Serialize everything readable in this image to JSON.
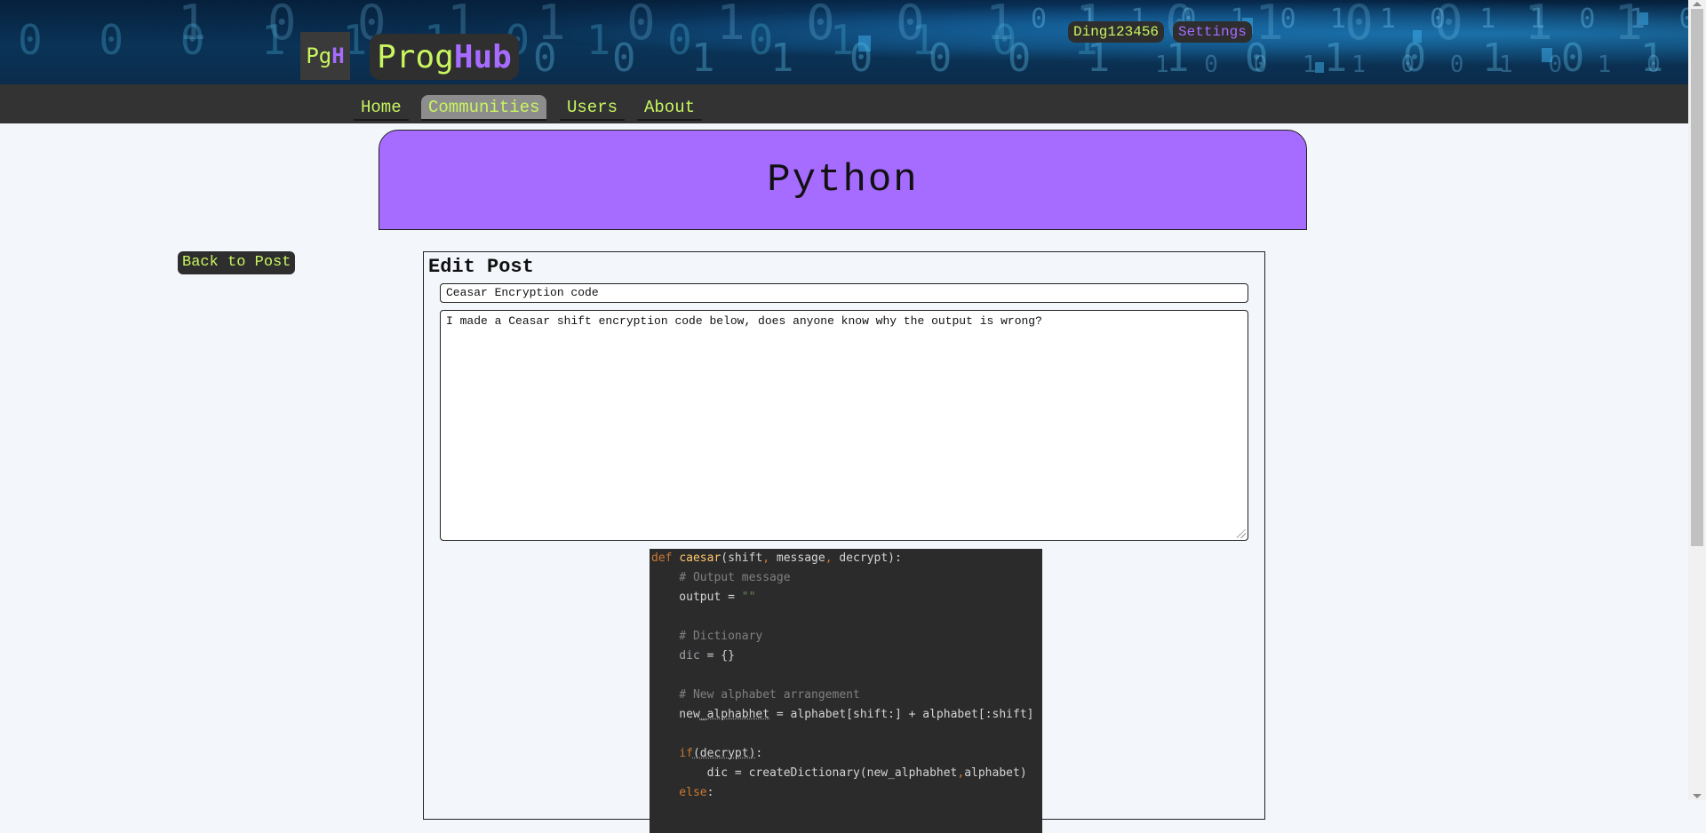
{
  "header": {
    "logo_small": {
      "prefix": "Pg",
      "suffix": "H"
    },
    "logo_big": {
      "prefix": "Prog",
      "suffix": "Hub"
    },
    "username": "Ding123456",
    "settings_label": "Settings"
  },
  "nav": {
    "items": [
      {
        "label": "Home"
      },
      {
        "label": "Communities",
        "active": true
      },
      {
        "label": "Users"
      },
      {
        "label": "About"
      }
    ]
  },
  "community": {
    "name": "Python"
  },
  "back_button": "Back to Post",
  "edit": {
    "heading": "Edit Post",
    "title_value": "Ceasar Encryption code",
    "body_value": "I made a Ceasar shift encryption code below, does anyone know why the output is wrong?"
  },
  "code": {
    "lines": [
      "def caesar(shift, message, decrypt):",
      "    # Output message",
      "    output = \"\"",
      "",
      "    # Dictionary",
      "    dic = {}",
      "",
      "    # New alphabet arrangement",
      "    new_alphabhet = alphabet[shift:] + alphabet[:shift]",
      "",
      "    if(decrypt):",
      "        dic = createDictionary(new_alphabhet,alphabet)",
      "    else:"
    ]
  },
  "colors": {
    "accent_green": "#c8f560",
    "accent_purple": "#a66bff",
    "nav_bg": "#333333",
    "page_bg": "#f3f7fb"
  }
}
